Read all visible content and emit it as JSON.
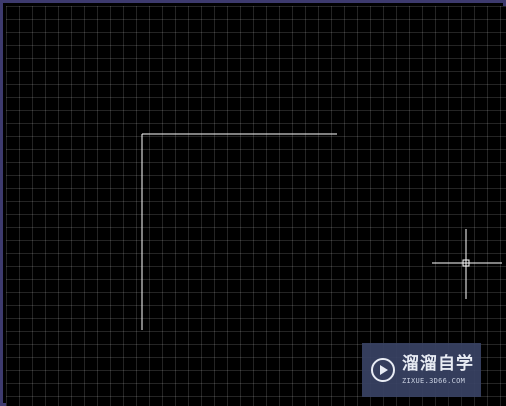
{
  "canvas": {
    "background": "#000000",
    "grid_color": "#2a2a2a",
    "line_color": "#ffffff",
    "frame_color": "#3d3a6e"
  },
  "cursor": {
    "icon": "crosshair-cursor-icon"
  },
  "watermark": {
    "icon": "play-logo-icon",
    "title": "溜溜自学",
    "url": "ZIXUE.3D66.COM"
  }
}
